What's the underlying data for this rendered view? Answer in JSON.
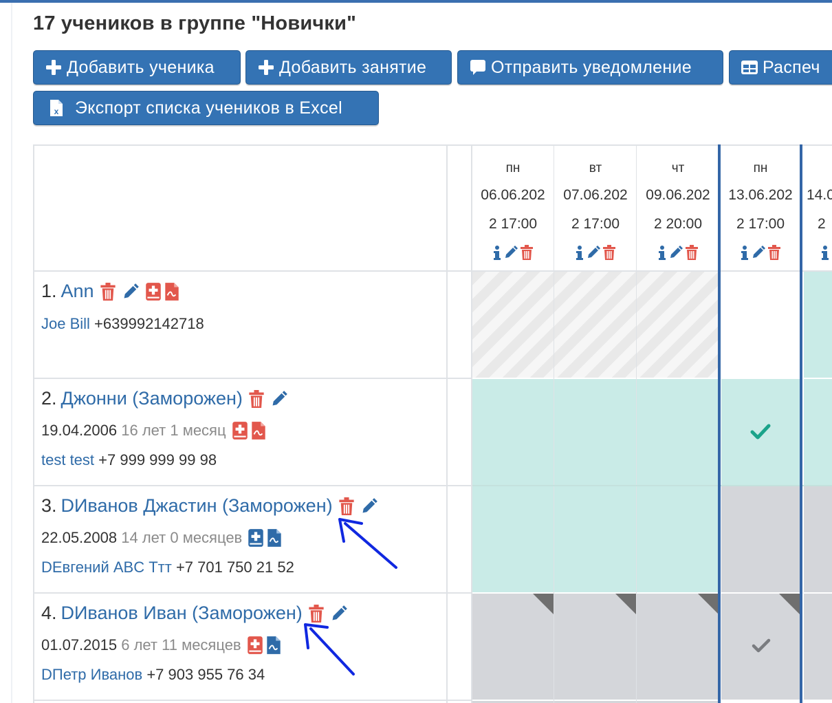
{
  "page": {
    "title": "17 учеников в группе \"Новички\""
  },
  "toolbar": {
    "add_student": "Добавить ученика",
    "add_lesson": "Добавить занятие",
    "send_notification": "Отправить уведомление",
    "print": "Распеч",
    "export_excel": "Экспорт списка учеников в Excel"
  },
  "colors": {
    "primary": "#3473b4",
    "teal_cell": "#c9ebe7",
    "grey_cell": "#d4d6da",
    "delete_red": "#e2574c",
    "check_green": "#1aa38a",
    "selected_column": "#3466a7"
  },
  "lessons": [
    {
      "dow": "пн",
      "date": "06.06.202",
      "time": "2 17:00"
    },
    {
      "dow": "вт",
      "date": "07.06.202",
      "time": "2 17:00"
    },
    {
      "dow": "чт",
      "date": "09.06.202",
      "time": "2 20:00"
    },
    {
      "dow": "пн",
      "date": "13.06.202",
      "time": "2 17:00"
    },
    {
      "dow": "",
      "date": "14.0",
      "time": "2"
    }
  ],
  "students": [
    {
      "num": "1.",
      "name": "Ann",
      "birth": "",
      "age": "",
      "parent": "Joe Bill",
      "phone": "+639992142718"
    },
    {
      "num": "2.",
      "name": "Джонни (Заморожен)",
      "birth": "19.04.2006",
      "age": "16 лет 1 месяц",
      "parent": "test test",
      "phone": "+7 999 999 99 98"
    },
    {
      "num": "3.",
      "name": "DИванов Джастин (Заморожен)",
      "birth": "22.05.2008",
      "age": "14 лет 0 месяцев",
      "parent": "DЕвгений ABC Ттт",
      "phone": "+7 701 750 21 52"
    },
    {
      "num": "4.",
      "name": "DИванов Иван (Заморожен)",
      "birth": "01.07.2015",
      "age": "6 лет 11 месяцев",
      "parent": "DПетр Иванов",
      "phone": "+7 903 955 76 34"
    }
  ],
  "icons": [
    "plus-icon",
    "comment-icon",
    "table-icon",
    "excel-file-icon",
    "info-icon",
    "pencil-icon",
    "trash-icon",
    "medical-book-icon",
    "document-icon",
    "check-icon",
    "annotation-arrow"
  ]
}
